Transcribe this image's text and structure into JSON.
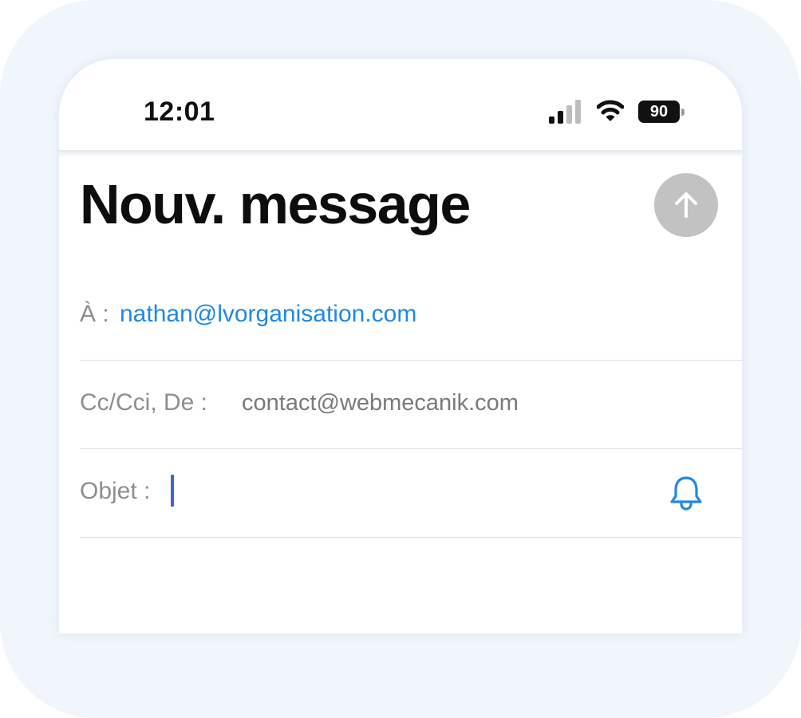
{
  "status_bar": {
    "time": "12:01",
    "signal_icon": "signal-bars-icon",
    "wifi_icon": "wifi-icon",
    "battery_level": "90"
  },
  "compose": {
    "title": "Nouv. message",
    "send_icon": "arrow-up-icon"
  },
  "fields": {
    "to": {
      "label": "À :",
      "value": "nathan@lvorganisation.com"
    },
    "cc_from": {
      "label": "Cc/Cci, De :",
      "value": "contact@webmecanik.com"
    },
    "subject": {
      "label": "Objet :",
      "value": "",
      "notify_icon": "bell-icon"
    }
  },
  "colors": {
    "accent_blue": "#1e88e5",
    "caret": "#3d63d9",
    "send_disabled": "#c2c2c2",
    "label_gray": "#8e8e8e",
    "outer_frame": "#f1f6fc"
  }
}
